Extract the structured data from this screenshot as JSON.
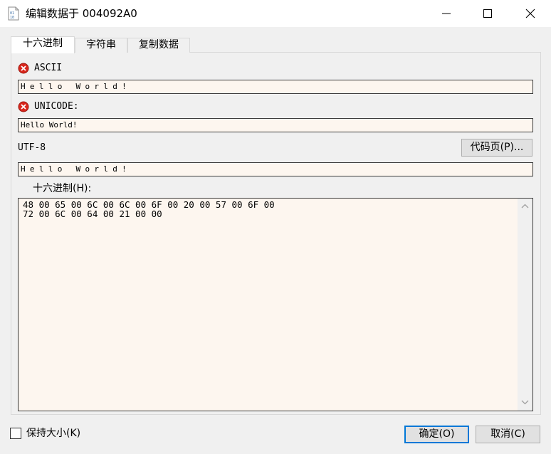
{
  "window": {
    "title": "编辑数据于 004092A0",
    "icon": "binary-file-icon",
    "controls": {
      "minimize": "minimize-icon",
      "maximize": "maximize-icon",
      "close": "close-icon"
    }
  },
  "tabs": [
    {
      "label": "十六进制",
      "active": true
    },
    {
      "label": "字符串",
      "active": false
    },
    {
      "label": "复制数据",
      "active": false
    }
  ],
  "ascii": {
    "label": "ASCII",
    "value": "Hello World!",
    "status_icon": "error-icon"
  },
  "unicode": {
    "label": "UNICODE:",
    "value": "Hello World!",
    "status_icon": "error-icon"
  },
  "utf8": {
    "label": "UTF-8",
    "value": "Hello World!"
  },
  "codepage_button": "代码页(P)...",
  "hex": {
    "label": "十六进制(H):",
    "lines": [
      "48 00 65 00 6C 00 6C 00 6F 00 20 00 57 00 6F 00",
      "72 00 6C 00 64 00 21 00 00"
    ]
  },
  "keep_size": {
    "label": "保持大小(K)",
    "checked": false
  },
  "buttons": {
    "ok": "确定(O)",
    "cancel": "取消(C)"
  },
  "colors": {
    "field_bg": "#fdf6ef",
    "window_bg": "#f0f0f0",
    "error": "#d9261c",
    "accent": "#0078d7"
  }
}
